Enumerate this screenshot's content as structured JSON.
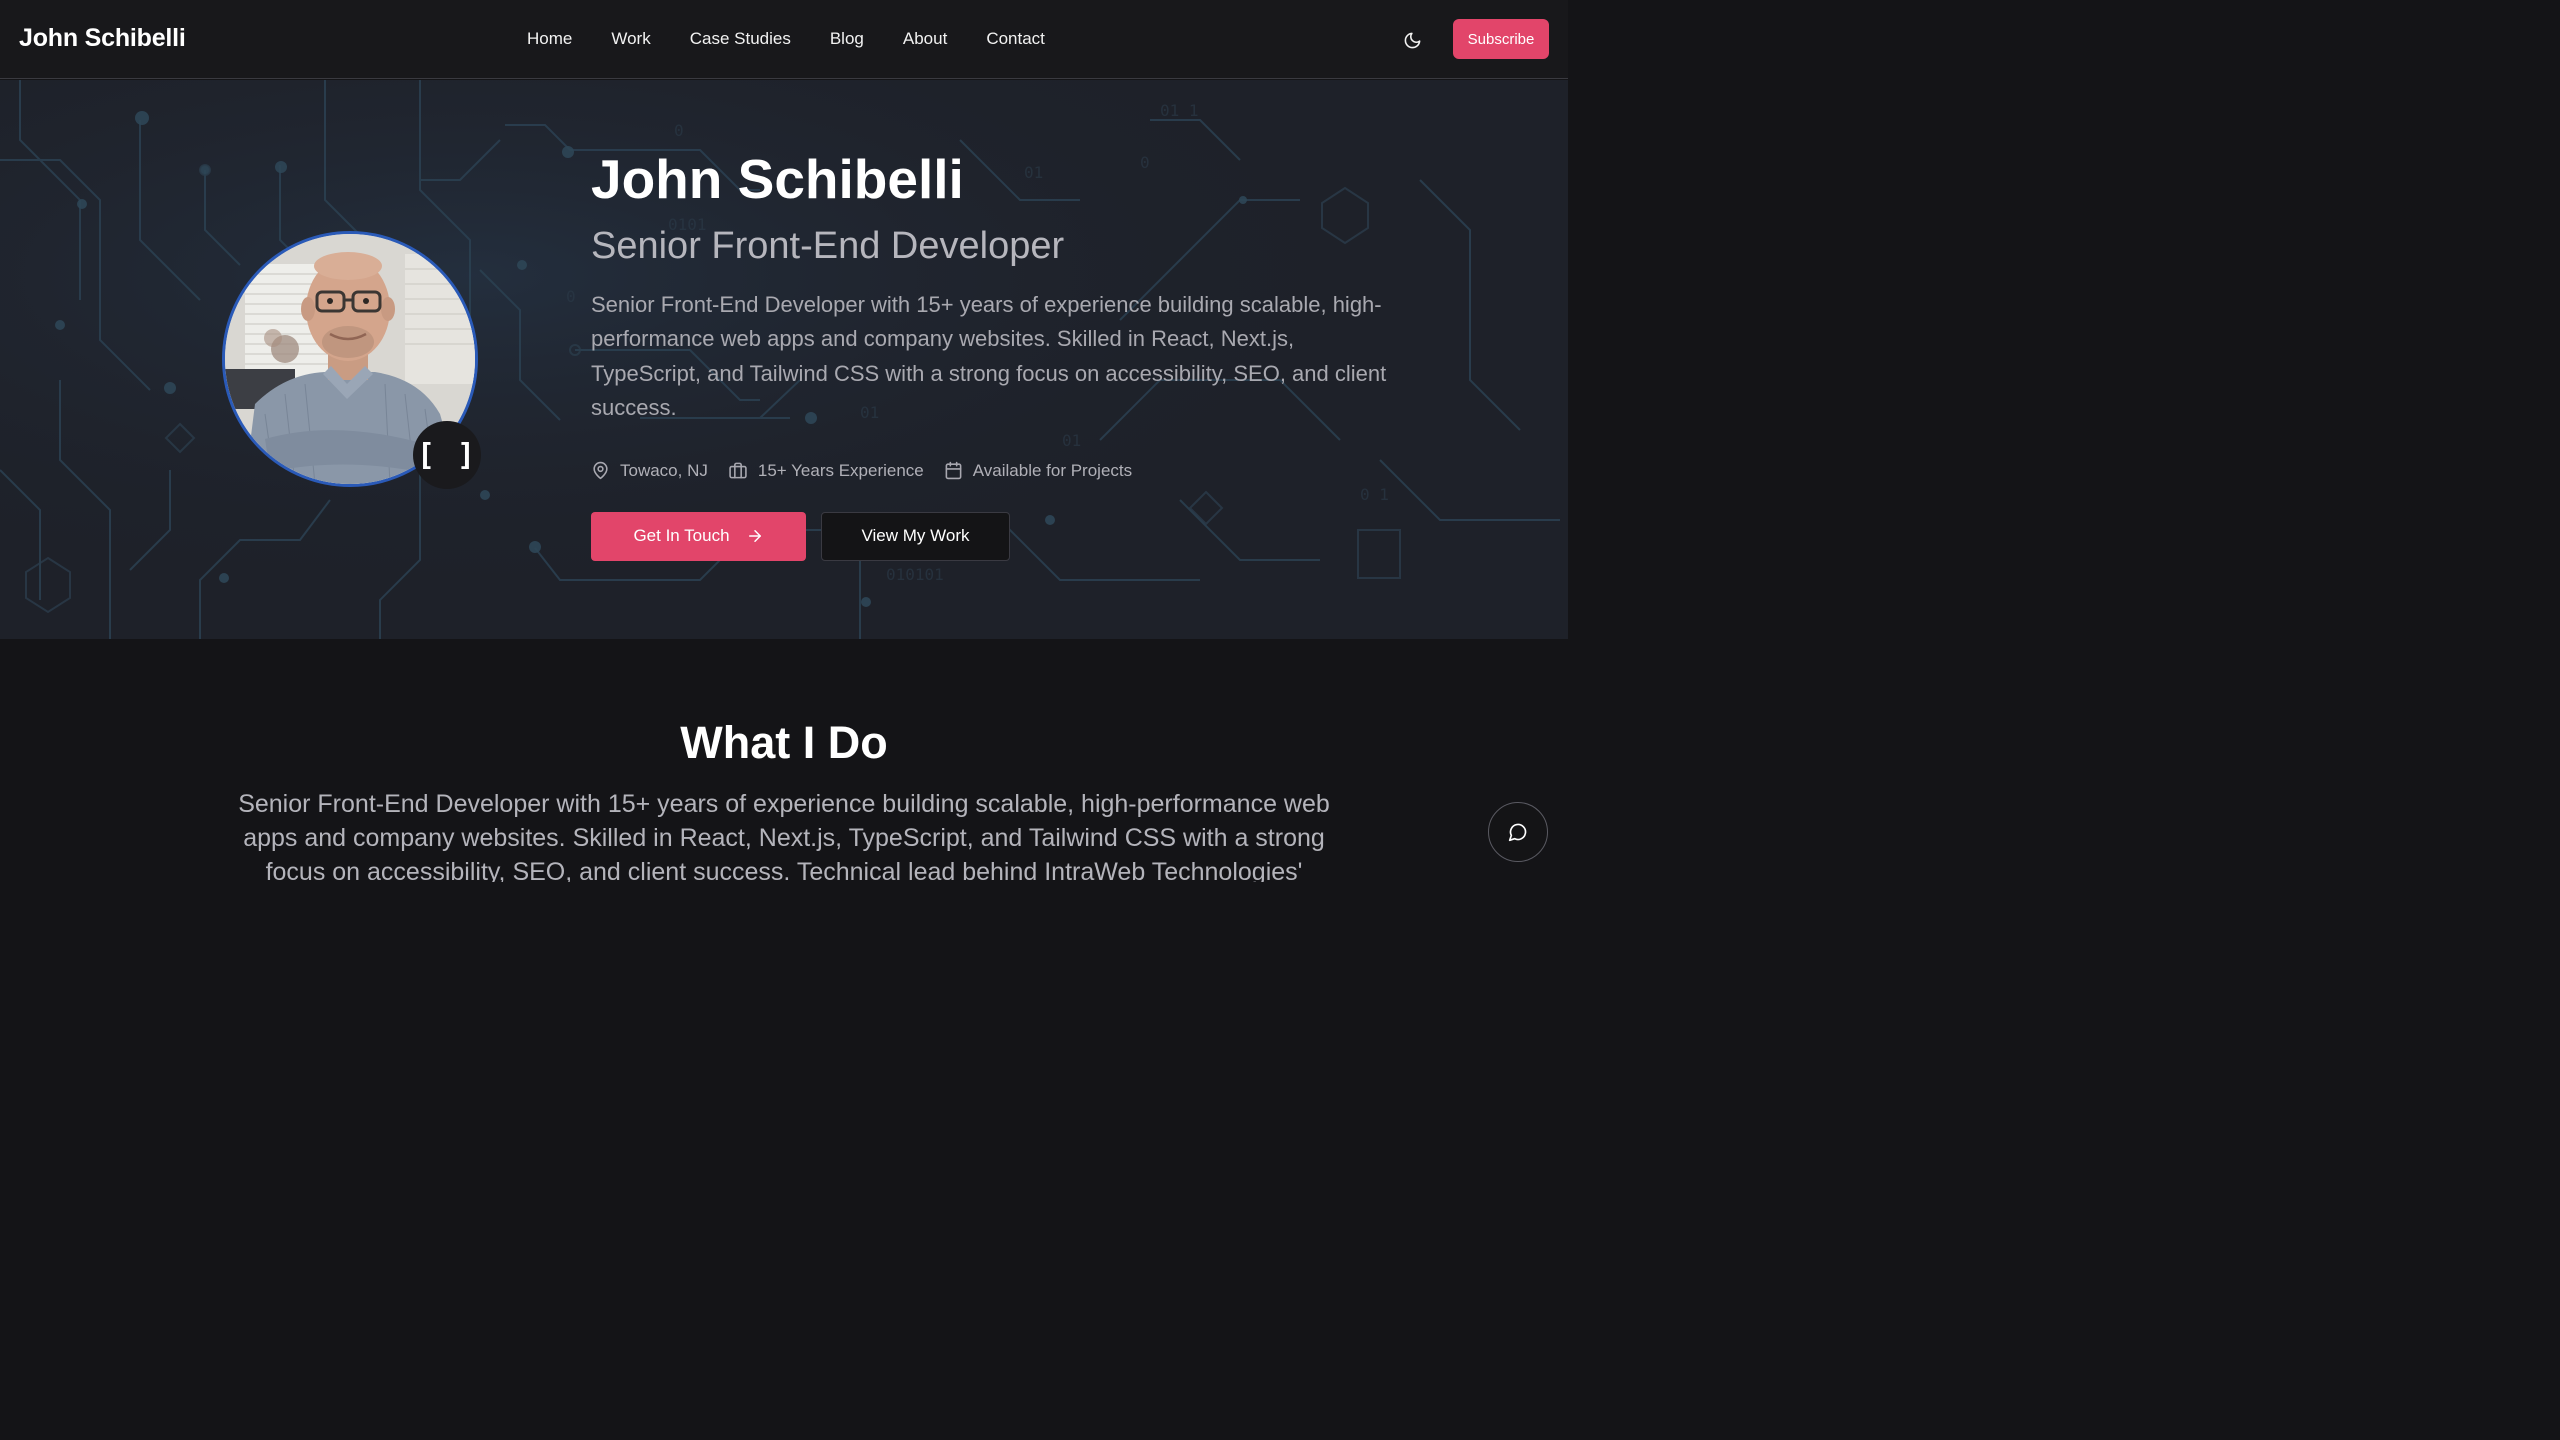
{
  "header": {
    "brand": "John Schibelli",
    "nav": [
      "Home",
      "Work",
      "Case Studies",
      "Blog",
      "About",
      "Contact"
    ],
    "subscribe_label": "Subscribe"
  },
  "hero": {
    "name": "John Schibelli",
    "role": "Senior Front-End Developer",
    "bio": "Senior Front-End Developer with 15+ years of experience building scalable, high-performance web apps and company websites. Skilled in React, Next.js, TypeScript, and Tailwind CSS with a strong focus on accessibility, SEO, and client success.",
    "badge": "[ ]",
    "meta": {
      "location": "Towaco, NJ",
      "experience": "15+ Years Experience",
      "availability": "Available for Projects"
    },
    "primary_cta": "Get In Touch",
    "secondary_cta": "View My Work"
  },
  "what_i_do": {
    "title": "What I Do",
    "text": "Senior Front-End Developer with 15+ years of experience building scalable, high-performance web apps and company websites. Skilled in React, Next.js, TypeScript, and Tailwind CSS with a strong focus on accessibility, SEO, and client success. Technical lead behind IntraWeb Technologies' digital"
  },
  "colors": {
    "accent": "#e2456a",
    "header_bg": "#18181b",
    "hero_bg": "#1e2129",
    "page_bg": "#141417",
    "avatar_ring": "#2a5ab8"
  },
  "icons": {
    "theme_toggle": "moon-icon",
    "location": "map-pin-icon",
    "experience": "briefcase-icon",
    "availability": "calendar-icon",
    "cta_arrow": "arrow-right-icon",
    "chat": "chat-bubble-icon"
  }
}
